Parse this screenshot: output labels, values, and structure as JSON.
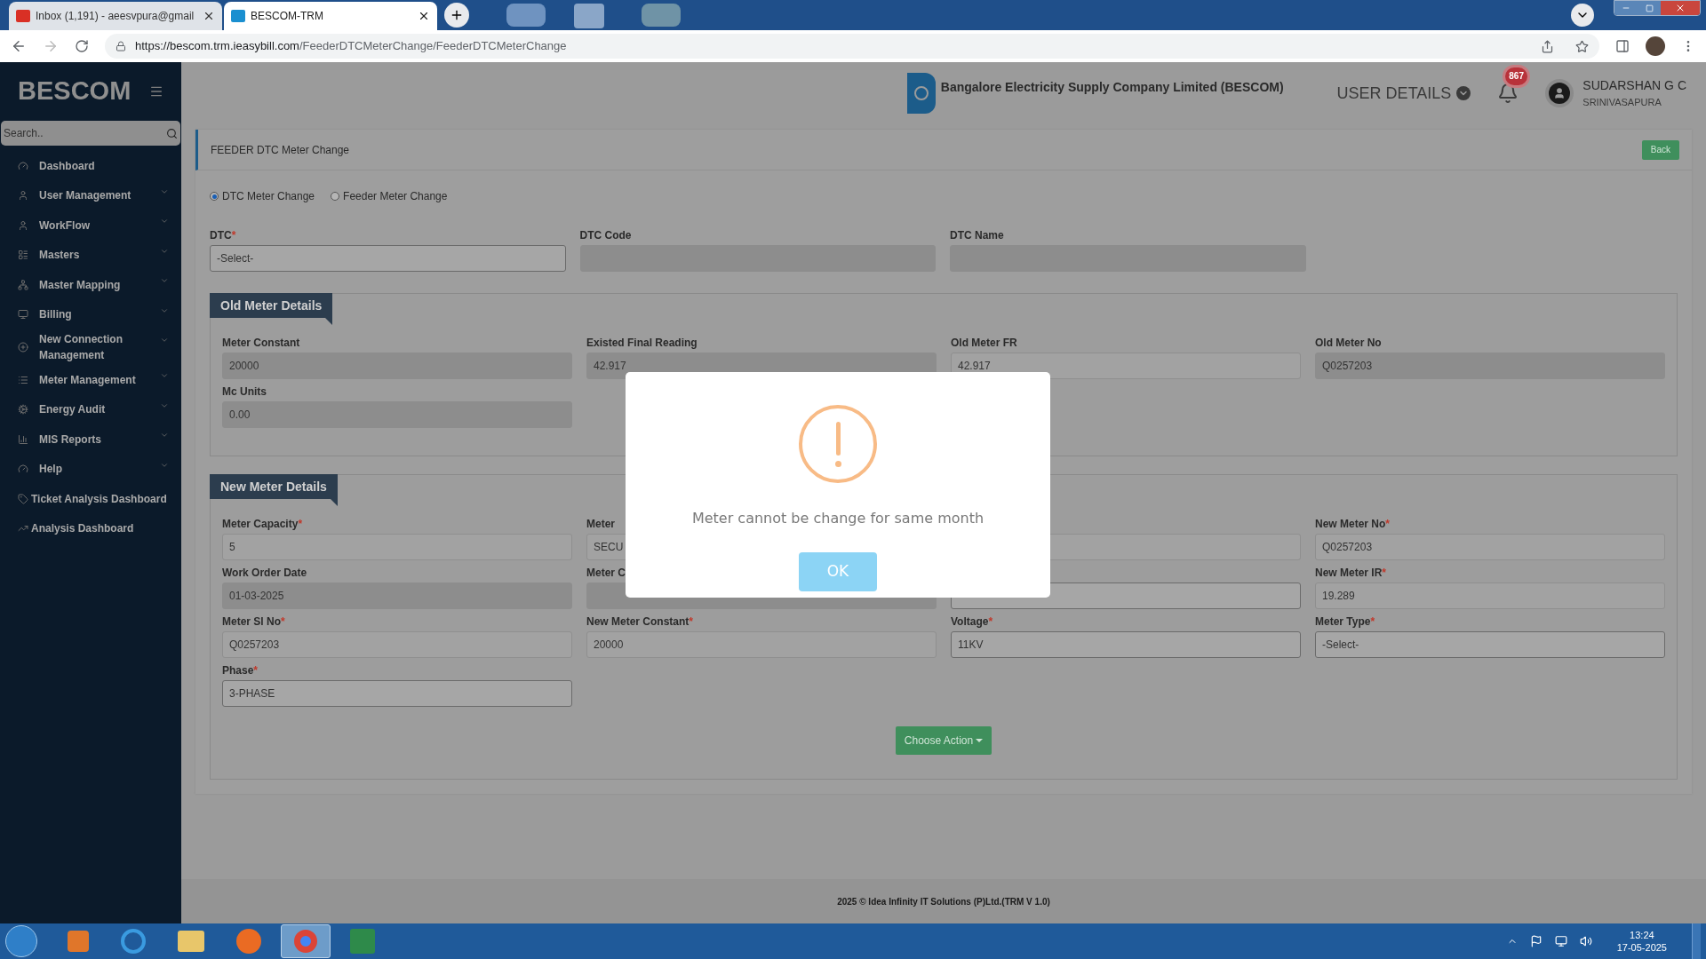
{
  "browser": {
    "tabs": [
      {
        "title": "Inbox (1,191) - aeesvpura@gmail",
        "selected": false
      },
      {
        "title": "BESCOM-TRM",
        "selected": true
      }
    ],
    "url_host": "https://bescom.trm.ieasybill.com",
    "url_path": "/FeederDTCMeterChange/FeederDTCMeterChange"
  },
  "sidebar": {
    "brand": "BESCOM",
    "search_placeholder": "Search..",
    "items": [
      {
        "label": "Dashboard",
        "expandable": false
      },
      {
        "label": "User Management",
        "expandable": true
      },
      {
        "label": "WorkFlow",
        "expandable": true
      },
      {
        "label": "Masters",
        "expandable": true
      },
      {
        "label": "Master Mapping",
        "expandable": true
      },
      {
        "label": "Billing",
        "expandable": true
      },
      {
        "label": "New Connection Management",
        "expandable": true
      },
      {
        "label": "Meter Management",
        "expandable": true
      },
      {
        "label": "Energy Audit",
        "expandable": true
      },
      {
        "label": "MIS Reports",
        "expandable": true
      },
      {
        "label": "Help",
        "expandable": true
      },
      {
        "label": "Ticket Analysis Dashboard",
        "expandable": false
      },
      {
        "label": "Analysis Dashboard",
        "expandable": false
      }
    ]
  },
  "header": {
    "org_name": "Bangalore Electricity Supply Company Limited (BESCOM)",
    "user_details": "USER DETAILS",
    "notification_count": "867",
    "user_name": "SUDARSHAN G C",
    "user_location": "SRINIVASAPURA"
  },
  "page": {
    "title": "FEEDER DTC Meter Change",
    "back_button": "Back",
    "radios": [
      {
        "label": "DTC Meter Change",
        "selected": true
      },
      {
        "label": "Feeder Meter Change",
        "selected": false
      }
    ],
    "dtc_fields": [
      {
        "label": "DTC",
        "required_mark": "*",
        "kind": "select",
        "value": "-Select-"
      },
      {
        "label": "DTC Code",
        "kind": "readonly"
      },
      {
        "label": "DTC Name",
        "kind": "readonly"
      }
    ],
    "old_meter": {
      "title": "Old Meter Details",
      "fields": [
        {
          "label": "Meter Constant",
          "kind": "readonly",
          "value": "20000"
        },
        {
          "label": "Existed Final Reading",
          "kind": "readonly",
          "value": "42.917"
        },
        {
          "label": "Old Meter FR",
          "kind": "input",
          "value": "42.917"
        },
        {
          "label": "Old Meter No",
          "kind": "readonly",
          "value": "Q0257203"
        },
        {
          "label": "Mc Units",
          "kind": "readonly",
          "value": "0.00"
        }
      ]
    },
    "new_meter": {
      "title": "New Meter Details",
      "fields": [
        {
          "label": "Meter Capacity",
          "required_mark": "*",
          "kind": "input",
          "value": "5"
        },
        {
          "label": "Meter",
          "kind": "input",
          "value": "SECU"
        },
        {
          "kind": "input"
        },
        {
          "label": "New Meter No",
          "required_mark": "*",
          "kind": "input",
          "value": "Q0257203"
        },
        {
          "label": "Work Order Date",
          "kind": "readonly",
          "value": "01-03-2025"
        },
        {
          "label": "Meter C",
          "kind": "readonly"
        },
        {
          "kind": "select"
        },
        {
          "label": "New Meter IR",
          "required_mark": "*",
          "kind": "input",
          "value": "19.289"
        },
        {
          "label": "Meter Sl No",
          "required_mark": "*",
          "kind": "input",
          "value": "Q0257203"
        },
        {
          "label": "New Meter Constant",
          "required_mark": "*",
          "kind": "input",
          "value": "20000"
        },
        {
          "label": "Voltage",
          "required_mark": "*",
          "kind": "select",
          "value": "11KV"
        },
        {
          "label": "Meter Type",
          "required_mark": "*",
          "kind": "select",
          "value": "-Select-"
        },
        {
          "label": "Phase",
          "required_mark": "*",
          "kind": "select",
          "value": "3-PHASE"
        }
      ]
    },
    "choose_action": "Choose Action",
    "footer": "2025 © Idea Infinity IT Solutions (P)Ltd.(TRM V 1.0)"
  },
  "dialog": {
    "message": "Meter cannot be change for same month",
    "button": "OK"
  },
  "taskbar": {
    "time": "13:24",
    "date": "17-05-2025"
  }
}
